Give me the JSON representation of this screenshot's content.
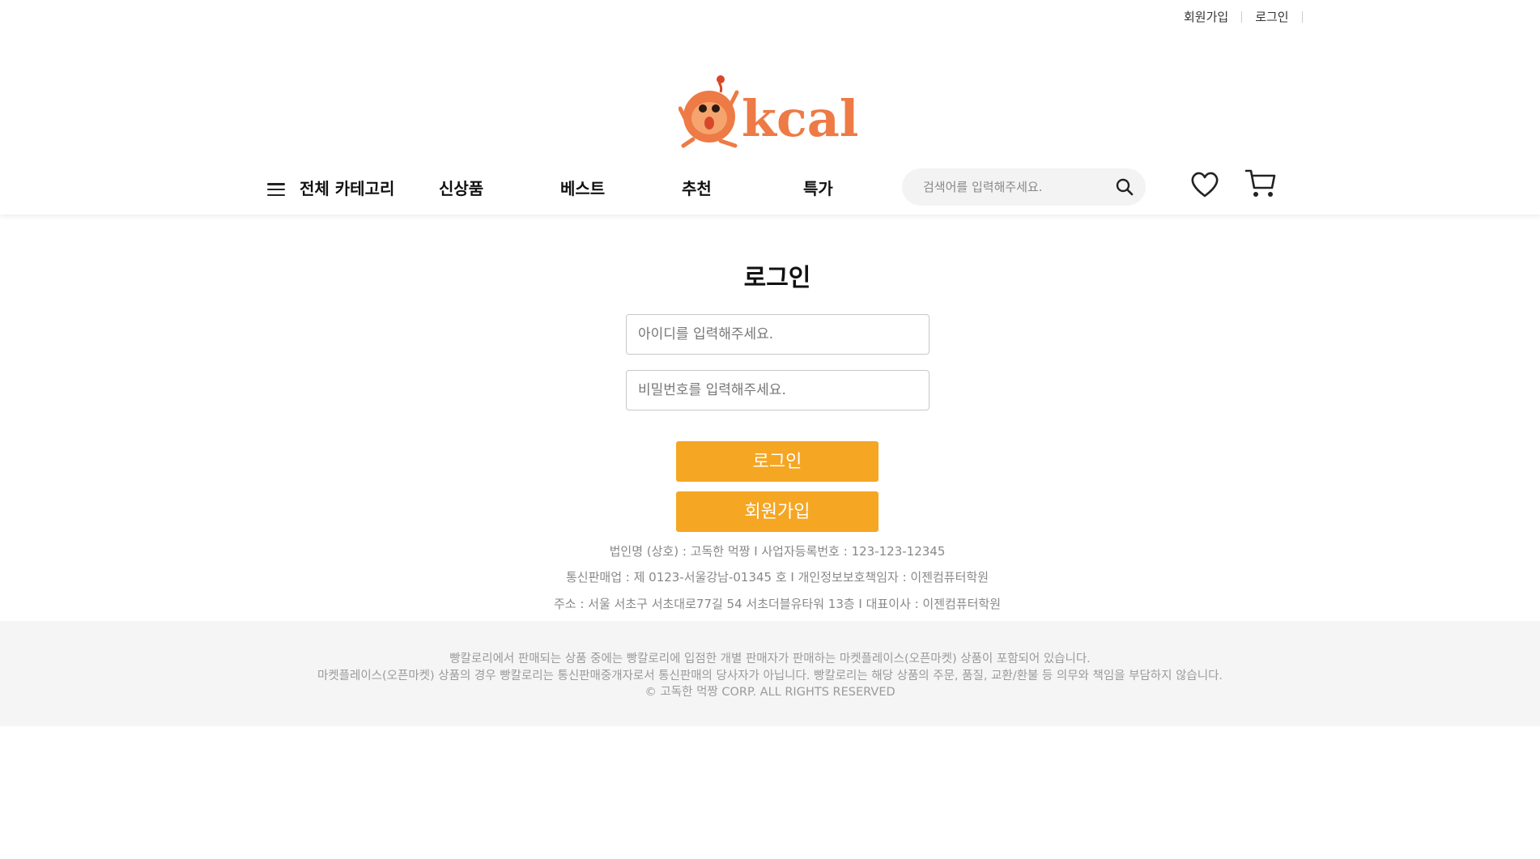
{
  "topbar": {
    "signup": "회원가입",
    "login": "로그인"
  },
  "logo": {
    "text": "kcal"
  },
  "nav": {
    "all_category": "전체 카테고리",
    "items": [
      "신상품",
      "베스트",
      "추천",
      "특가"
    ]
  },
  "search": {
    "placeholder": "검색어를 입력해주세요."
  },
  "icons": {
    "menu": "hamburger-icon",
    "search": "search-icon",
    "wishlist": "heart-icon",
    "cart": "cart-icon"
  },
  "login_form": {
    "title": "로그인",
    "id_placeholder": "아이디를 입력해주세요.",
    "pw_placeholder": "비밀번호를 입력해주세요.",
    "login_button": "로그인",
    "signup_button": "회원가입"
  },
  "company_info": {
    "line1": "법인명 (상호) : 고독한 먹짱 I 사업자등록번호 : 123-123-12345",
    "line2": "통신판매업 : 제 0123-서울강남-01345 호 I 개인정보보호책임자 : 이젠컴퓨터학원",
    "line3": "주소 : 서울 서초구 서초대로77길 54 서초더블유타워 13층 I 대표이사 : 이젠컴퓨터학원"
  },
  "footer": {
    "line1": "빵칼로리에서 판매되는 상품 중에는 빵칼로리에 입점한 개별 판매자가 판매하는 마켓플레이스(오픈마켓) 상품이 포함되어 있습니다.",
    "line2": "마켓플레이스(오픈마켓) 상품의 경우 빵칼로리는 통신판매중개자로서 통신판매의 당사자가 아닙니다. 빵칼로리는 해당 상품의 주문, 품질, 교환/환불 등 의무와 책임을 부담하지 않습니다.",
    "copyright": "© 고독한 먹짱 CORP. ALL RIGHTS RESERVED"
  },
  "colors": {
    "accent": "#f5a623",
    "logo": "#ee7a45"
  }
}
